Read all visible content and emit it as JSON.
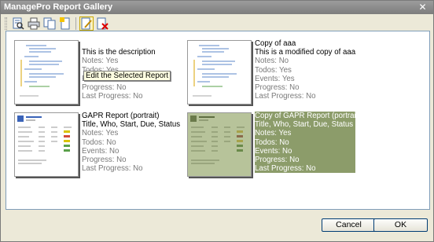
{
  "window": {
    "title": "ManagePro Report Gallery",
    "close_glyph": "✕"
  },
  "toolbar": {
    "buttons": [
      {
        "icon": "preview-report-icon"
      },
      {
        "icon": "print-report-icon"
      },
      {
        "icon": "copy-report-icon"
      },
      {
        "icon": "new-report-icon"
      },
      {
        "icon": "edit-report-icon"
      },
      {
        "icon": "delete-report-icon"
      }
    ]
  },
  "tooltip": {
    "text": "Edit the Selected Report"
  },
  "reports": [
    {
      "name": "",
      "description": "This is the description",
      "notes": "Notes: Yes",
      "todos": "Todos: Yes",
      "events": "Events: Yes",
      "progress": "Progress: No",
      "last_progress": "Last Progress: No",
      "selected": false
    },
    {
      "name": "Copy of aaa",
      "description": "This is a modified copy of aaa",
      "notes": "Notes: No",
      "todos": "Todos: Yes",
      "events": "Events: Yes",
      "progress": "Progress: No",
      "last_progress": "Last Progress: No",
      "selected": false
    },
    {
      "name": "GAPR Report (portrait)",
      "description": "Title, Who, Start, Due, Status",
      "notes": "Notes: Yes",
      "todos": "Todos: No",
      "events": "Events: No",
      "progress": "Progress: No",
      "last_progress": "Last Progress: No",
      "selected": false
    },
    {
      "name": "Copy of GAPR Report (portrait)",
      "description": "Title, Who, Start, Due, Status",
      "notes": "Notes: Yes",
      "todos": "Todos: No",
      "events": "Events: No",
      "progress": "Progress: No",
      "last_progress": "Last Progress: No",
      "selected": true
    }
  ],
  "buttons": {
    "cancel": "Cancel",
    "ok": "OK"
  }
}
